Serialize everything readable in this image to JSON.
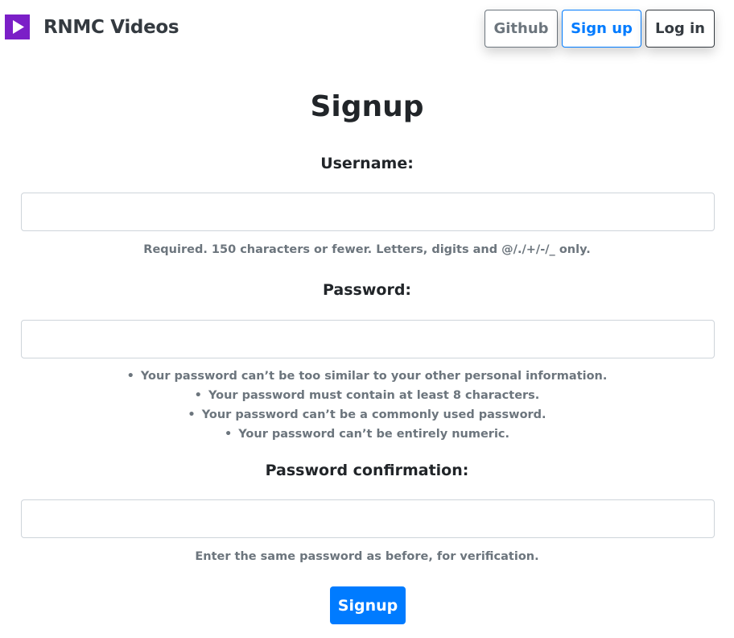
{
  "brand": {
    "title": "RNMC Videos",
    "logo_icon": "play-icon",
    "logo_color": "#7b1fc7"
  },
  "nav": {
    "github_label": "Github",
    "signup_label": "Sign up",
    "login_label": "Log in"
  },
  "form": {
    "title": "Signup",
    "username": {
      "label": "Username:",
      "value": "",
      "help": "Required. 150 characters or fewer. Letters, digits and @/./+/-/_ only."
    },
    "password": {
      "label": "Password:",
      "value": "",
      "help_items": [
        "Your password can’t be too similar to your other personal information.",
        "Your password must contain at least 8 characters.",
        "Your password can’t be a commonly used password.",
        "Your password can’t be entirely numeric."
      ]
    },
    "password_confirmation": {
      "label": "Password confirmation:",
      "value": "",
      "help": "Enter the same password as before, for verification."
    },
    "submit_label": "Signup"
  },
  "colors": {
    "primary": "#007bff",
    "secondary": "#6c757d",
    "dark": "#343a40"
  }
}
